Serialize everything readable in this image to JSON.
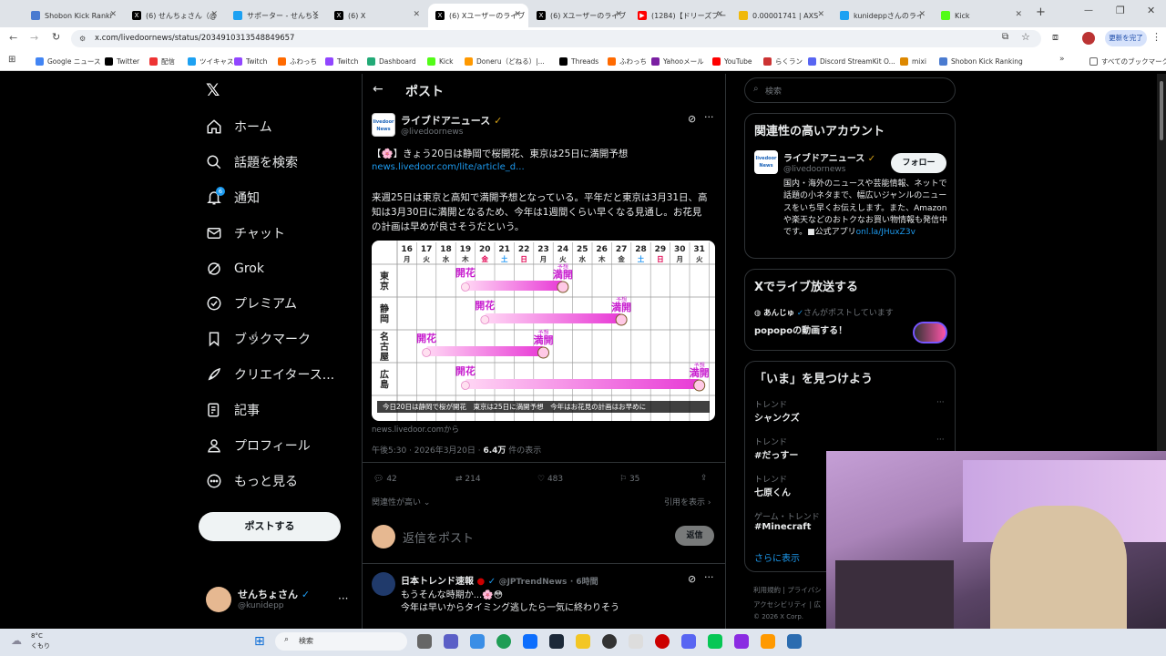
{
  "browser": {
    "tabs": [
      {
        "label": "Shobon Kick Ranki",
        "color": "#4a7bd0"
      },
      {
        "label": "(6) せんちょさん（@",
        "color": "#000"
      },
      {
        "label": "サポーター - せんちょ",
        "color": "#1da1f2"
      },
      {
        "label": "(6) X",
        "color": "#000"
      },
      {
        "label": "(6) Xユーザーのライブ",
        "color": "#000"
      },
      {
        "label": "(6) Xユーザーのライブ",
        "color": "#000"
      },
      {
        "label": "(1284)【ドリーズブー",
        "color": "#ff0000"
      },
      {
        "label": "0.00001741 | AXS",
        "color": "#f0b90b"
      },
      {
        "label": "kunideppさんのライ",
        "color": "#1da1f2"
      },
      {
        "label": "Kick",
        "color": "#53fc18"
      }
    ],
    "url": "x.com/livedoornews/status/2034910313548849657",
    "update_button": "更新を完了",
    "bookmarks": [
      "Google ニュース",
      "Twitter",
      "配信",
      "ツイキャス",
      "Twitch",
      "ふわっち",
      "Twitch",
      "Dashboard",
      "Kick",
      "Doneru（どねる）|...",
      "Threads",
      "ふわっち",
      "Yahooメール",
      "YouTube",
      "らくラン",
      "Discord StreamKit O...",
      "mixi",
      "Shobon Kick Ranking"
    ],
    "all_bookmarks": "すべてのブックマーク"
  },
  "nav": {
    "items": [
      "ホーム",
      "話題を検索",
      "通知",
      "チャット",
      "Grok",
      "プレミアム",
      "ブックマーク",
      "クリエイタース...",
      "記事",
      "プロフィール",
      "もっと見る"
    ],
    "notif_badge": "6",
    "post_button": "ポストする",
    "account": {
      "name": "せんちょさん",
      "handle": "@kunidepp"
    }
  },
  "post": {
    "header_title": "ポスト",
    "author": "ライブドアニュース",
    "handle": "@livedoornews",
    "line1": "【🌸】きょう20日は静岡で桜開花、東京は25日に満開予想",
    "link": "news.livedoor.com/lite/article_d...",
    "body": "来週25日は東京と高知で満開予想となっている。平年だと東京は3月31日、高知は3月30日に満開となるため、今年は1週間くらい早くなる見通し。お花見の計画は早めが良さそうだという。",
    "source": "news.livedoor.comから",
    "time": "午後5:30 · 2026年3月20日 · ",
    "views": "6.4万",
    "views_suffix": " 件の表示",
    "stats": {
      "replies": "42",
      "reposts": "214",
      "likes": "483",
      "bookmarks": "35"
    },
    "relevance": "関連性が高い",
    "quotes": "引用を表示",
    "reply_placeholder": "返信をポスト",
    "reply_button": "返信"
  },
  "chart": {
    "days": [
      "16",
      "17",
      "18",
      "19",
      "20",
      "21",
      "22",
      "23",
      "24",
      "25",
      "26",
      "27",
      "28",
      "29",
      "30",
      "31"
    ],
    "weekdays": [
      "月",
      "火",
      "水",
      "木",
      "金",
      "土",
      "日",
      "月",
      "火",
      "水",
      "木",
      "金",
      "土",
      "日",
      "月",
      "火"
    ],
    "weekday_colors": [
      "#333",
      "#333",
      "#333",
      "#333",
      "#e0004f",
      "#2196f3",
      "#e0004f",
      "#333",
      "#333",
      "#333",
      "#333",
      "#333",
      "#2196f3",
      "#e0004f",
      "#333",
      "#333"
    ],
    "cities": [
      "東京",
      "静岡",
      "名古屋",
      "広島"
    ],
    "bloom_label": "開花",
    "full_label": "満開",
    "forecast_label": "予想",
    "caption": "今日20日は静岡で桜が開花　東京は25日に満開予想　今年はお花見の計画はお早めに"
  },
  "reply2": {
    "author": "日本トレンド速報",
    "handle": "@JPTrendNews",
    "time": "· 6時間",
    "line1": "もうそんな時期か...🌸😳",
    "line2": "今年は早いからタイミング逃したら一気に終わりそう"
  },
  "right": {
    "search_placeholder": "検索",
    "related_title": "関連性の高いアカウント",
    "acct_name": "ライブドアニュース",
    "acct_handle": "@livedoornews",
    "follow": "フォロー",
    "bio": "国内・海外のニュースや芸能情報、ネットで話題の小ネタまで、幅広いジャンルのニュースをいち早くお伝えします。また、Amazonや楽天などのおトクなお買い物情報も発信中です。■公式アプリ",
    "bio_link": "onl.la/JHuxZ3v",
    "live_title": "Xでライブ放送する",
    "live_user": "あんじゅ",
    "live_suffix": "さんがポストしています",
    "live_text": "popopoの動画する！",
    "trend_title": "「いま」を見つけよう",
    "trends": [
      {
        "cat": "トレンド",
        "name": "シャンクズ"
      },
      {
        "cat": "トレンド",
        "name": "#だっすー"
      },
      {
        "cat": "トレンド",
        "name": "七原くん"
      },
      {
        "cat": "ゲーム・トレンド",
        "name": "#Minecraft"
      }
    ],
    "show_more": "さらに表示",
    "footer1": "利用規約 | プライバシ",
    "footer2": "アクセシビリティ | 広",
    "footer3": "© 2026 X Corp."
  },
  "taskbar": {
    "weather_temp": "8°C",
    "weather_desc": "くもり",
    "search": "検索"
  }
}
